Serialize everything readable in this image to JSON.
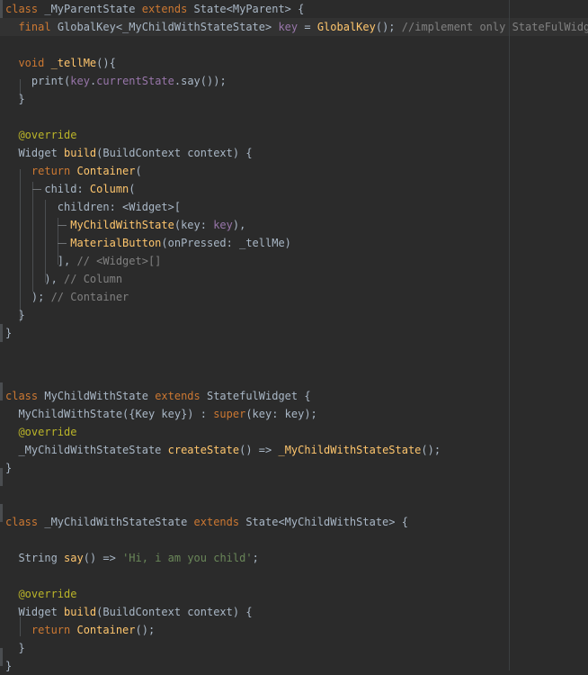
{
  "colors": {
    "background": "#2b2b2b",
    "current_line": "#323232",
    "keyword": "#cc7832",
    "function": "#ffc66d",
    "field": "#9876aa",
    "annotation": "#bbb529",
    "string": "#6a8759",
    "comment": "#808080",
    "plain": "#a9b7c6"
  },
  "lines": [
    {
      "tokens": [
        {
          "t": "kw",
          "s": "class "
        },
        {
          "t": "plain",
          "s": "_MyParentState "
        },
        {
          "t": "kw",
          "s": "extends "
        },
        {
          "t": "plain",
          "s": "State<MyParent> {"
        }
      ]
    },
    {
      "tokens": [
        {
          "t": "plain",
          "s": "  "
        },
        {
          "t": "kw",
          "s": "final "
        },
        {
          "t": "plain",
          "s": "GlobalKey<_MyChildWithStateState> "
        },
        {
          "t": "field",
          "s": "key"
        },
        {
          "t": "plain",
          "s": " = "
        },
        {
          "t": "fn",
          "s": "GlobalKey"
        },
        {
          "t": "plain",
          "s": "(); "
        },
        {
          "t": "com",
          "s": "//implement only StateFulWidget"
        }
      ]
    },
    {
      "tokens": []
    },
    {
      "tokens": [
        {
          "t": "plain",
          "s": "  "
        },
        {
          "t": "kw",
          "s": "void "
        },
        {
          "t": "fn",
          "s": "_tellMe"
        },
        {
          "t": "plain",
          "s": "(){"
        }
      ]
    },
    {
      "tokens": [
        {
          "t": "plain",
          "s": "    print("
        },
        {
          "t": "field",
          "s": "key"
        },
        {
          "t": "plain",
          "s": "."
        },
        {
          "t": "field",
          "s": "currentState"
        },
        {
          "t": "plain",
          "s": ".say());"
        }
      ]
    },
    {
      "tokens": [
        {
          "t": "plain",
          "s": "  }"
        }
      ]
    },
    {
      "tokens": []
    },
    {
      "tokens": [
        {
          "t": "plain",
          "s": "  "
        },
        {
          "t": "ann",
          "s": "@override"
        }
      ]
    },
    {
      "tokens": [
        {
          "t": "plain",
          "s": "  Widget "
        },
        {
          "t": "fn",
          "s": "build"
        },
        {
          "t": "plain",
          "s": "(BuildContext context) {"
        }
      ]
    },
    {
      "tokens": [
        {
          "t": "plain",
          "s": "    "
        },
        {
          "t": "kw",
          "s": "return "
        },
        {
          "t": "fn",
          "s": "Container"
        },
        {
          "t": "plain",
          "s": "("
        }
      ]
    },
    {
      "tokens": [
        {
          "t": "plain",
          "s": "      child: "
        },
        {
          "t": "fn",
          "s": "Column"
        },
        {
          "t": "plain",
          "s": "("
        }
      ]
    },
    {
      "tokens": [
        {
          "t": "plain",
          "s": "        children: <Widget>["
        }
      ]
    },
    {
      "tokens": [
        {
          "t": "plain",
          "s": "          "
        },
        {
          "t": "fn",
          "s": "MyChildWithState"
        },
        {
          "t": "plain",
          "s": "(key: "
        },
        {
          "t": "field",
          "s": "key"
        },
        {
          "t": "plain",
          "s": "),"
        }
      ]
    },
    {
      "tokens": [
        {
          "t": "plain",
          "s": "          "
        },
        {
          "t": "fn",
          "s": "MaterialButton"
        },
        {
          "t": "plain",
          "s": "(onPressed: _tellMe)"
        }
      ]
    },
    {
      "tokens": [
        {
          "t": "plain",
          "s": "        ], "
        },
        {
          "t": "com",
          "s": "// <Widget>[]"
        }
      ]
    },
    {
      "tokens": [
        {
          "t": "plain",
          "s": "      ), "
        },
        {
          "t": "com",
          "s": "// Column"
        }
      ]
    },
    {
      "tokens": [
        {
          "t": "plain",
          "s": "    ); "
        },
        {
          "t": "com",
          "s": "// Container"
        }
      ]
    },
    {
      "tokens": [
        {
          "t": "plain",
          "s": "  }"
        }
      ]
    },
    {
      "tokens": [
        {
          "t": "plain",
          "s": "}"
        }
      ]
    },
    {
      "tokens": []
    },
    {
      "tokens": []
    },
    {
      "tokens": []
    },
    {
      "tokens": [
        {
          "t": "kw",
          "s": "class "
        },
        {
          "t": "plain",
          "s": "MyChildWithState "
        },
        {
          "t": "kw",
          "s": "extends "
        },
        {
          "t": "plain",
          "s": "StatefulWidget {"
        }
      ]
    },
    {
      "tokens": [
        {
          "t": "plain",
          "s": "  MyChildWithState({Key key}) : "
        },
        {
          "t": "kw",
          "s": "super"
        },
        {
          "t": "plain",
          "s": "(key: key);"
        }
      ]
    },
    {
      "tokens": [
        {
          "t": "plain",
          "s": "  "
        },
        {
          "t": "ann",
          "s": "@override"
        }
      ]
    },
    {
      "tokens": [
        {
          "t": "plain",
          "s": "  _MyChildWithStateState "
        },
        {
          "t": "fn",
          "s": "createState"
        },
        {
          "t": "plain",
          "s": "() => "
        },
        {
          "t": "fn",
          "s": "_MyChildWithStateState"
        },
        {
          "t": "plain",
          "s": "();"
        }
      ]
    },
    {
      "tokens": [
        {
          "t": "plain",
          "s": "}"
        }
      ]
    },
    {
      "tokens": []
    },
    {
      "tokens": [
        {
          "t": "kw",
          "s": "class "
        },
        {
          "t": "plain",
          "s": "_MyChildWithStateState "
        },
        {
          "t": "kw",
          "s": "extends "
        },
        {
          "t": "plain",
          "s": "State<MyChildWithState> {"
        }
      ]
    },
    {
      "tokens": []
    },
    {
      "tokens": [
        {
          "t": "plain",
          "s": "  String "
        },
        {
          "t": "fn",
          "s": "say"
        },
        {
          "t": "plain",
          "s": "() => "
        },
        {
          "t": "str",
          "s": "'Hi, i am you child'"
        },
        {
          "t": "plain",
          "s": ";"
        }
      ]
    },
    {
      "tokens": []
    },
    {
      "tokens": [
        {
          "t": "plain",
          "s": "  "
        },
        {
          "t": "ann",
          "s": "@override"
        }
      ]
    },
    {
      "tokens": [
        {
          "t": "plain",
          "s": "  Widget "
        },
        {
          "t": "fn",
          "s": "build"
        },
        {
          "t": "plain",
          "s": "(BuildContext context) {"
        }
      ]
    },
    {
      "tokens": [
        {
          "t": "plain",
          "s": "    "
        },
        {
          "t": "kw",
          "s": "return "
        },
        {
          "t": "fn",
          "s": "Container"
        },
        {
          "t": "plain",
          "s": "();"
        }
      ]
    },
    {
      "tokens": [
        {
          "t": "plain",
          "s": "  }"
        }
      ]
    },
    {
      "tokens": [
        {
          "t": "plain",
          "s": "}"
        }
      ]
    }
  ]
}
